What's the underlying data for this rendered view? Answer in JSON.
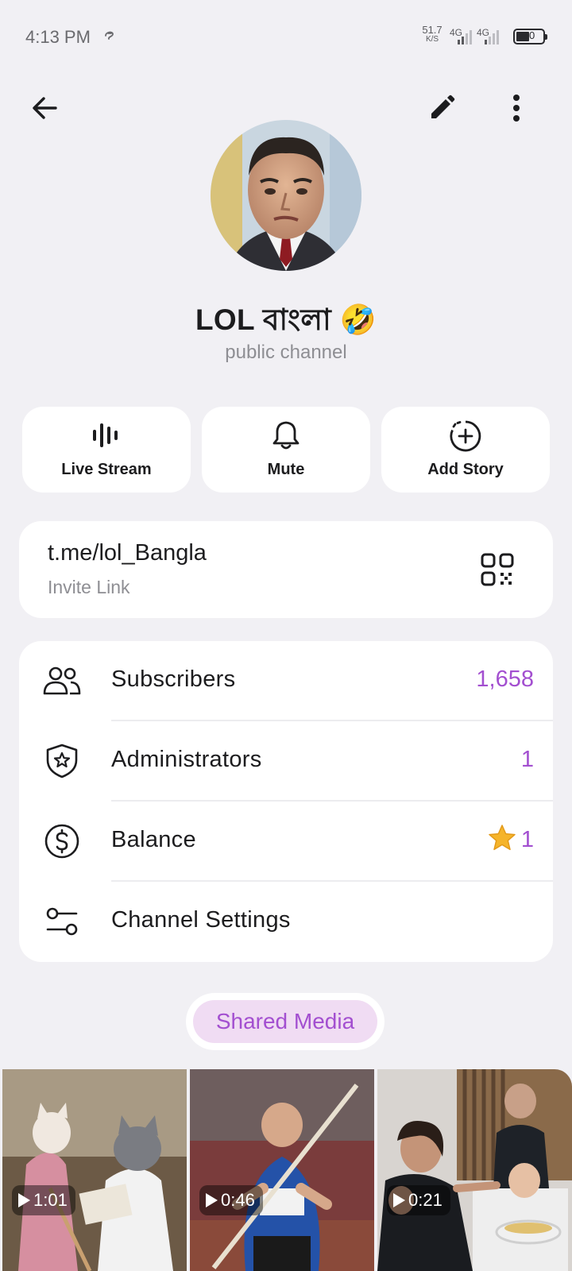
{
  "status_bar": {
    "time": "4:13 PM",
    "net_speed_value": "51.7",
    "net_speed_unit": "K/S",
    "signal_1_label": "4G",
    "signal_2_label": "4G",
    "battery": "40"
  },
  "header": {
    "back_icon": "arrow-left-icon",
    "edit_icon": "pencil-icon",
    "menu_icon": "more-vertical-icon"
  },
  "profile": {
    "name": "LOL বাংলা",
    "emoji": "🤣",
    "subtitle": "public channel"
  },
  "actions": [
    {
      "label": "Live Stream",
      "icon": "live-stream-icon"
    },
    {
      "label": "Mute",
      "icon": "bell-icon"
    },
    {
      "label": "Add Story",
      "icon": "add-story-icon"
    }
  ],
  "invite": {
    "link": "t.me/lol_Bangla",
    "label": "Invite Link",
    "icon": "qr-code-icon"
  },
  "info_rows": [
    {
      "label": "Subscribers",
      "value": "1,658",
      "icon": "users-icon"
    },
    {
      "label": "Administrators",
      "value": "1",
      "icon": "shield-star-icon"
    },
    {
      "label": "Balance",
      "value": "1",
      "icon": "dollar-circle-icon",
      "value_icon": "star-icon"
    },
    {
      "label": "Channel Settings",
      "value": "",
      "icon": "settings-sliders-icon"
    }
  ],
  "shared_media": {
    "label": "Shared Media",
    "items": [
      {
        "duration": "1:01",
        "icon": "play-icon"
      },
      {
        "duration": "0:46",
        "icon": "play-icon"
      },
      {
        "duration": "0:21",
        "icon": "play-icon"
      }
    ]
  },
  "colors": {
    "accent": "#a34fd0",
    "pill_bg": "#f0dcf3",
    "background": "#f1f0f4",
    "card": "#ffffff"
  }
}
